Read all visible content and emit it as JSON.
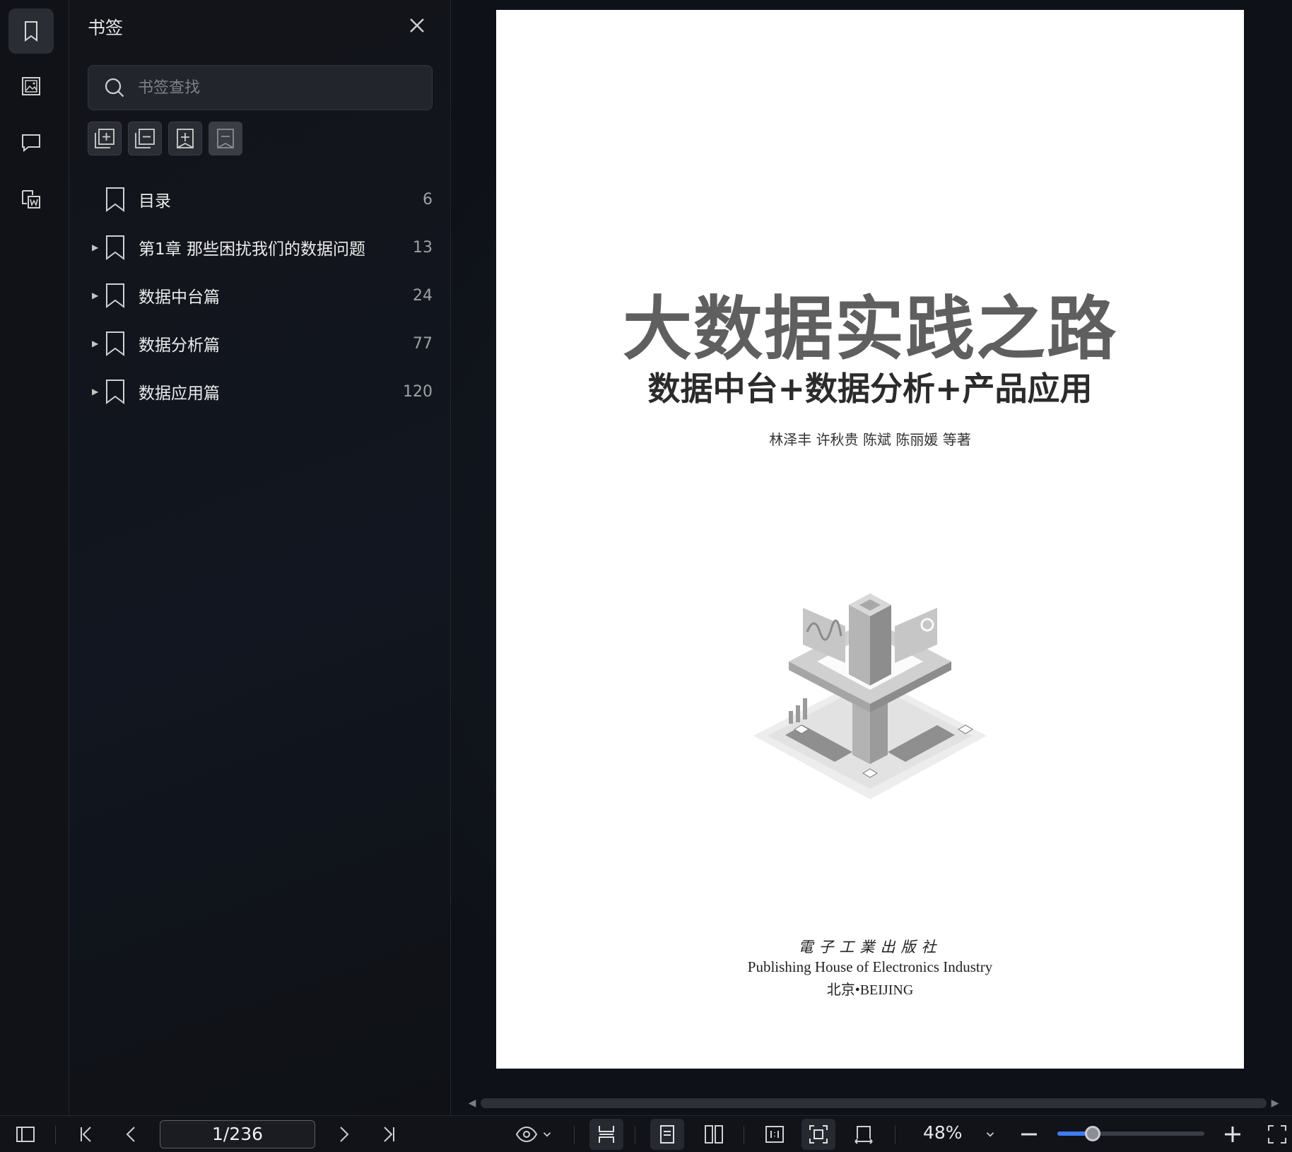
{
  "sidebar_panel": {
    "title": "书签",
    "search_placeholder": "书签查找",
    "bookmarks": [
      {
        "label": "目录",
        "page": "6",
        "expandable": false
      },
      {
        "label": "第1章 那些困扰我们的数据问题",
        "page": "13",
        "expandable": true
      },
      {
        "label": "数据中台篇",
        "page": "24",
        "expandable": true
      },
      {
        "label": "数据分析篇",
        "page": "77",
        "expandable": true
      },
      {
        "label": "数据应用篇",
        "page": "120",
        "expandable": true
      }
    ]
  },
  "document_page": {
    "title": "大数据实践之路",
    "subtitle": "数据中台+数据分析+产品应用",
    "authors": "林泽丰  许秋贵  陈斌  陈丽媛  等著",
    "publisher_cn": "電子工業出版社",
    "publisher_en": "Publishing House of Electronics Industry",
    "publisher_city": "北京•BEIJING"
  },
  "bottom_bar": {
    "page_indicator": "1/236",
    "zoom": "48%",
    "zoom_level": 0.24
  },
  "colors": {
    "accent": "#3f7bf5",
    "panel_bg": "#121419",
    "page_bg": "#ffffff"
  }
}
